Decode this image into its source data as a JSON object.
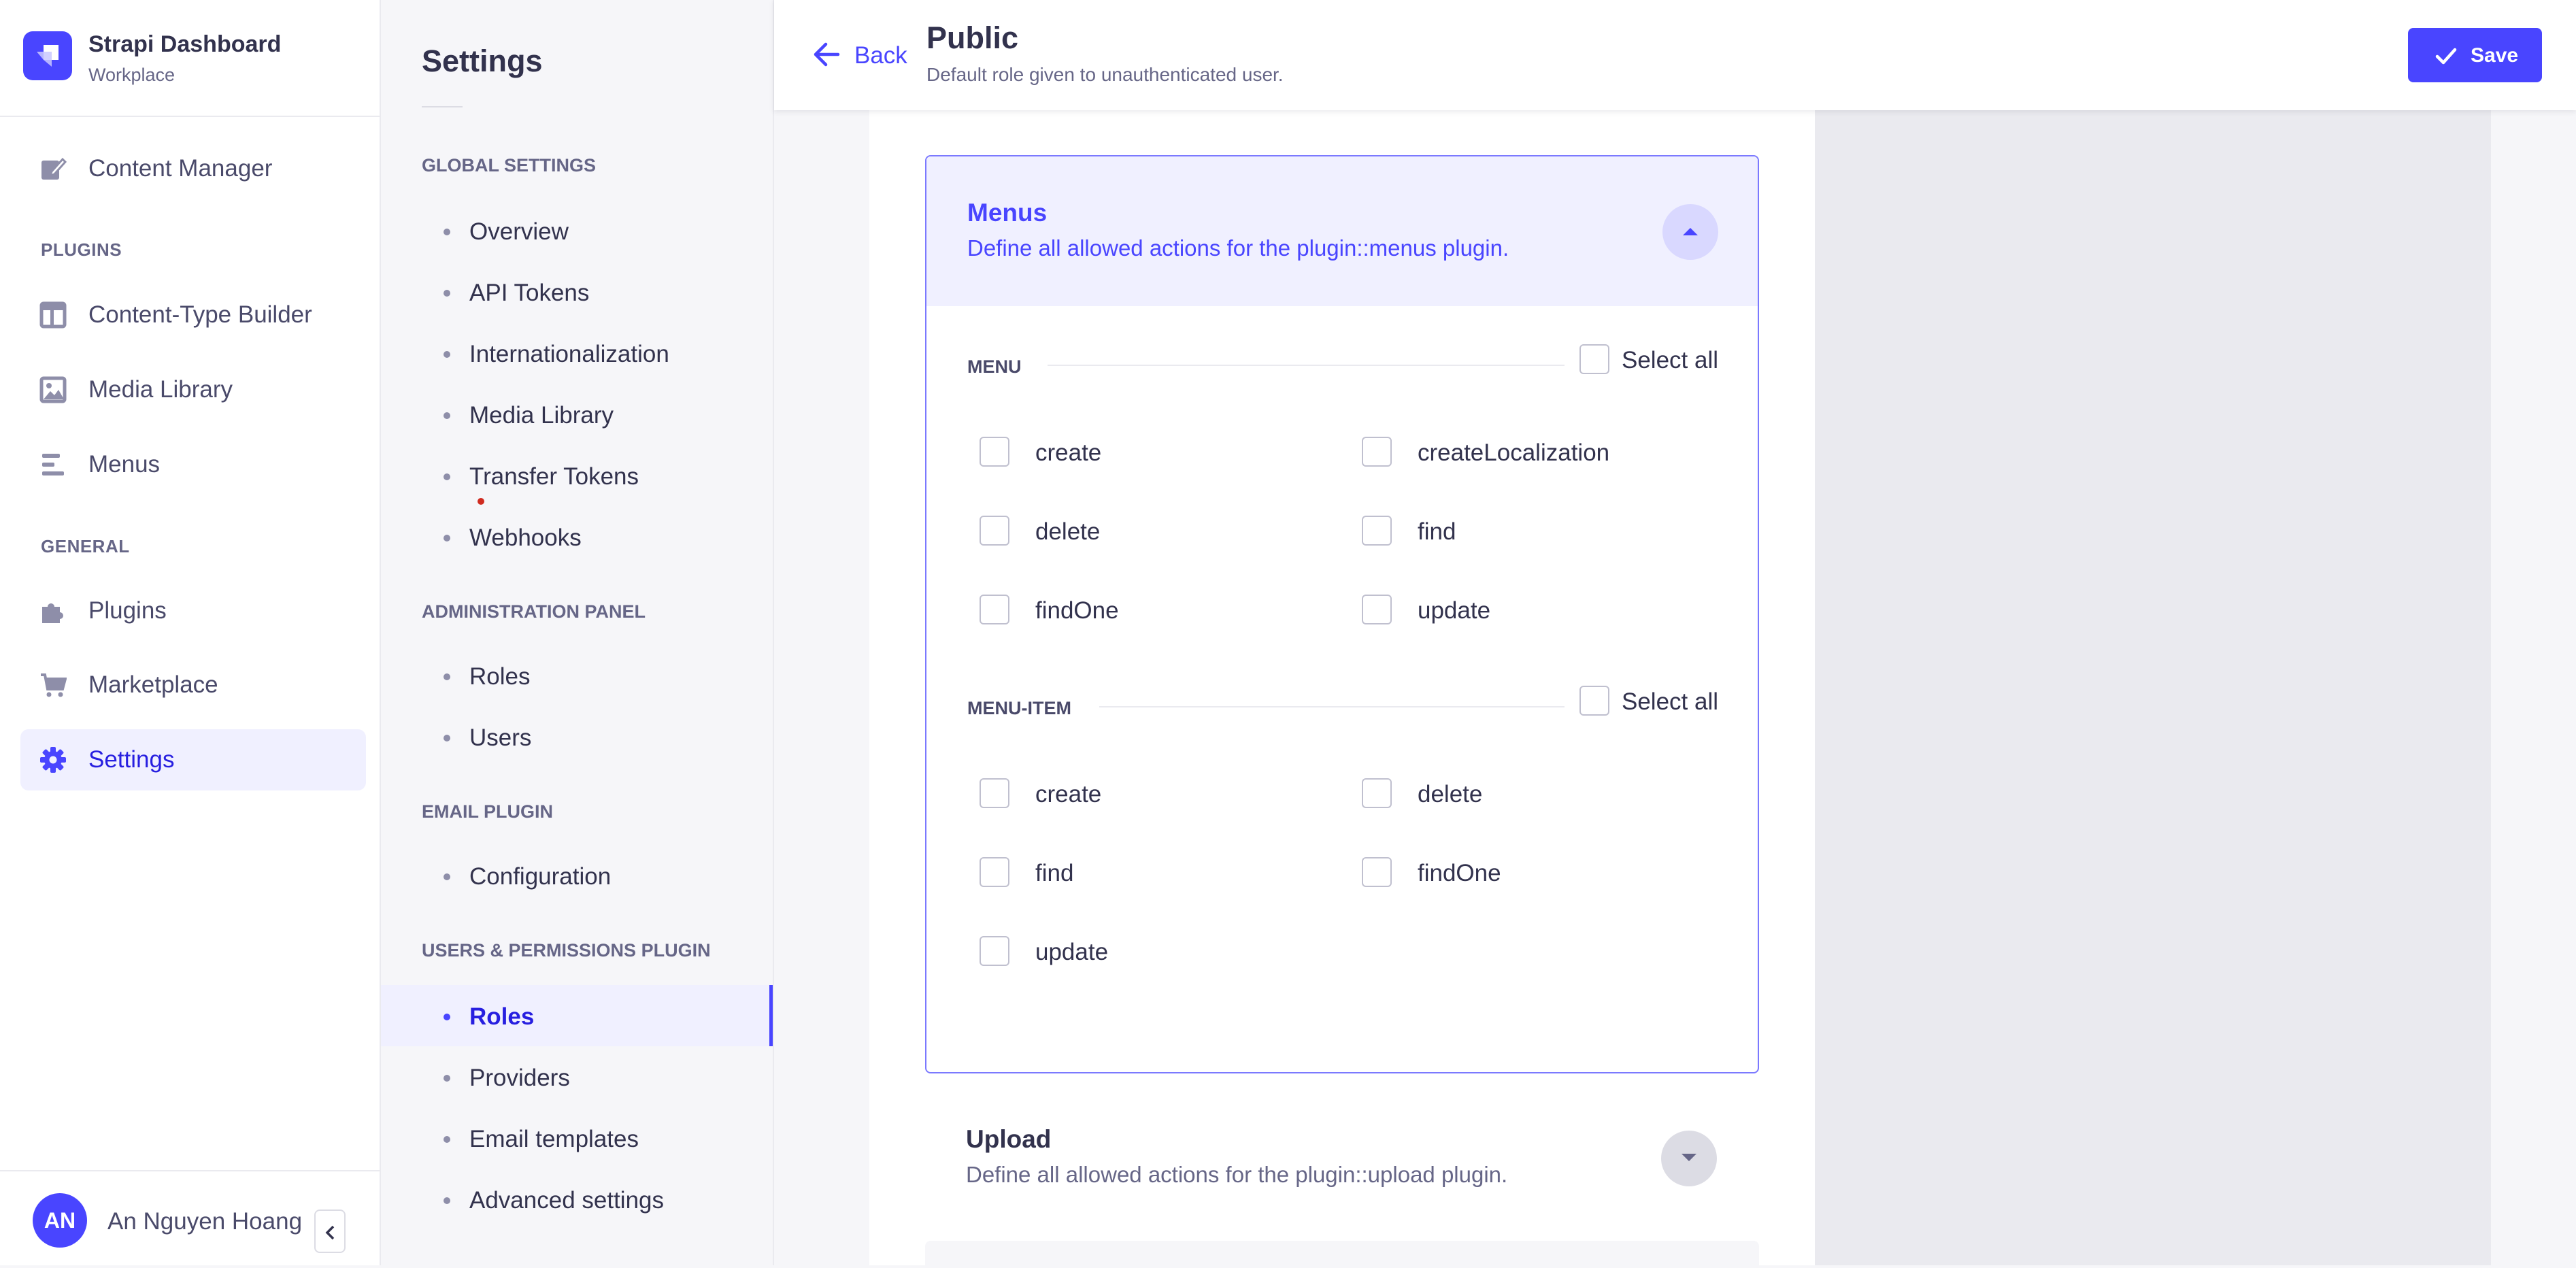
{
  "brand": {
    "title": "Strapi Dashboard",
    "subtitle": "Workplace"
  },
  "main_nav": {
    "items": [
      {
        "label": "Content Manager",
        "icon": "pencil-note-icon"
      },
      {
        "label": "Content-Type Builder",
        "icon": "layout-icon"
      },
      {
        "label": "Media Library",
        "icon": "image-icon"
      },
      {
        "label": "Menus",
        "icon": "menu-lines-icon"
      },
      {
        "label": "Plugins",
        "icon": "puzzle-icon"
      },
      {
        "label": "Marketplace",
        "icon": "cart-icon"
      },
      {
        "label": "Settings",
        "icon": "gear-icon",
        "active": true
      }
    ],
    "sections": {
      "plugins": "PLUGINS",
      "general": "GENERAL"
    }
  },
  "user": {
    "initials": "AN",
    "name": "An Nguyen Hoang"
  },
  "settings_nav": {
    "title": "Settings",
    "sections": {
      "global": "GLOBAL SETTINGS",
      "admin": "ADMINISTRATION PANEL",
      "email": "EMAIL PLUGIN",
      "users_permissions": "USERS & PERMISSIONS PLUGIN"
    },
    "global_items": [
      "Overview",
      "API Tokens",
      "Internationalization",
      "Media Library",
      "Transfer Tokens",
      "Webhooks"
    ],
    "admin_items": [
      "Roles",
      "Users"
    ],
    "email_items": [
      "Configuration"
    ],
    "up_items": [
      "Roles",
      "Providers",
      "Email templates",
      "Advanced settings"
    ],
    "active_item": "Roles"
  },
  "header": {
    "back_label": "Back",
    "title": "Public",
    "subtitle": "Default role given to unauthenticated user.",
    "save_label": "Save"
  },
  "menus_panel": {
    "title": "Menus",
    "description": "Define all allowed actions for the plugin::menus plugin.",
    "select_all_label": "Select all",
    "groups": [
      {
        "name": "MENU",
        "actions": [
          "create",
          "createLocalization",
          "delete",
          "find",
          "findOne",
          "update"
        ]
      },
      {
        "name": "MENU-ITEM",
        "actions": [
          "create",
          "delete",
          "find",
          "findOne",
          "update"
        ]
      }
    ]
  },
  "upload_panel": {
    "title": "Upload",
    "description": "Define all allowed actions for the plugin::upload plugin."
  },
  "colors": {
    "accent": "#4945ff",
    "active_bg": "#f0f0ff",
    "text": "#32324d",
    "muted": "#666687"
  }
}
